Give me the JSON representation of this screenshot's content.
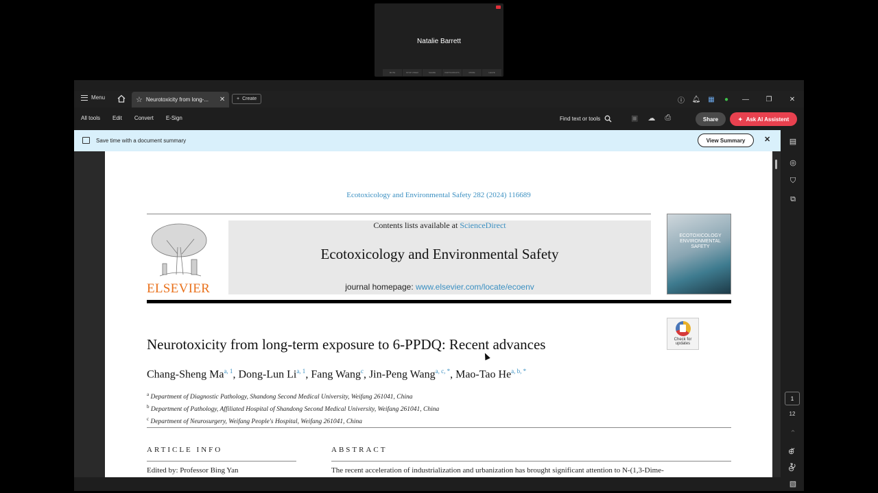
{
  "video_call": {
    "participant_name": "Natalie Barrett",
    "controls": [
      "MUTE",
      "STOP VIDEO",
      "SHARE",
      "PARTICIPANTS",
      "MORE",
      "LEAVE"
    ]
  },
  "app": {
    "menu_label": "Menu",
    "tab_title": "Neurotoxicity from long-...",
    "create_label": "Create",
    "nav": [
      "All tools",
      "Edit",
      "Convert",
      "E-Sign"
    ],
    "find_label": "Find text or tools",
    "share_label": "Share",
    "ask_ai_label": "Ask AI Assistent",
    "accent_color": "#e8414f"
  },
  "banner": {
    "text": "Save time with a document summary",
    "button": "View Summary"
  },
  "paper": {
    "citation": "Ecotoxicology and Environmental Safety 282 (2024) 116689",
    "contents_prefix": "Contents lists available at ",
    "contents_link": "ScienceDirect",
    "journal_title": "Ecotoxicology and Environmental Safety",
    "homepage_prefix": "journal homepage: ",
    "homepage_url": "www.elsevier.com/locate/ecoenv",
    "publisher": "ELSEVIER",
    "cover_text": "ECOTOXICOLOGY ENVIRONMENTAL SAFETY",
    "check_updates": "Check for updates",
    "title": "Neurotoxicity from long-term exposure to 6-PPDQ: Recent advances",
    "authors": [
      {
        "name": "Chang-Sheng Ma",
        "sup": "a, 1"
      },
      {
        "name": "Dong-Lun Li",
        "sup": "a, 1"
      },
      {
        "name": "Fang Wang",
        "sup": "c"
      },
      {
        "name": "Jin-Peng Wang",
        "sup": "a, c, *"
      },
      {
        "name": "Mao-Tao He",
        "sup": "a, b, *"
      }
    ],
    "affiliations": [
      {
        "key": "a",
        "text": "Department of Diagnostic Pathology, Shandong Second Medical University, Weifang 261041, China"
      },
      {
        "key": "b",
        "text": "Department of Pathology, Affiliated Hospital of Shandong Second Medical University, Weifang 261041, China"
      },
      {
        "key": "c",
        "text": "Department of Neurosurgery, Weifang People's Hospital, Weifang 261041, China"
      }
    ],
    "article_info_heading": "ARTICLE INFO",
    "abstract_heading": "ABSTRACT",
    "edited_by": "Edited by: Professor Bing Yan",
    "abstract_start": "The recent acceleration of industrialization and urbanization has brought significant attention to N-(1,3-Dime-"
  },
  "page_nav": {
    "current": "1",
    "total": "12"
  }
}
